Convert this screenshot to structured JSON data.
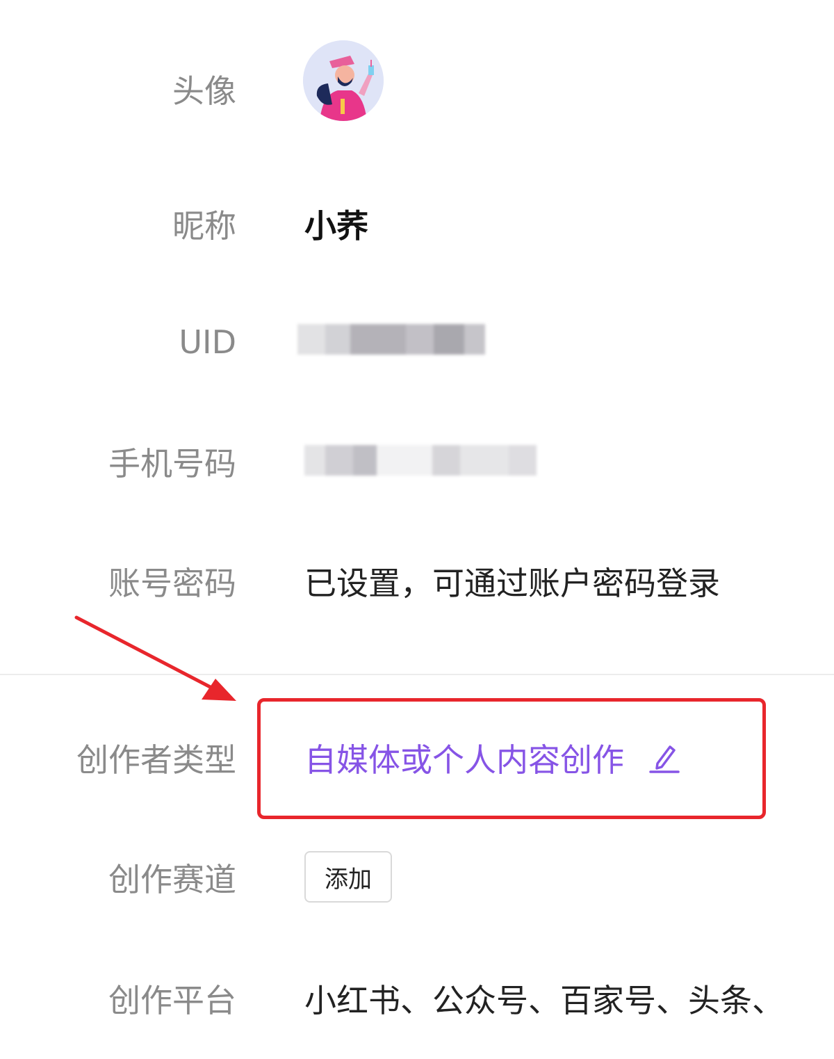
{
  "profile": {
    "avatar_label": "头像",
    "nickname_label": "昵称",
    "nickname_value": "小荞",
    "uid_label": "UID",
    "phone_label": "手机号码",
    "password_label": "账号密码",
    "password_value": "已设置，可通过账户密码登录",
    "creator_type_label": "创作者类型",
    "creator_type_value": "自媒体或个人内容创作",
    "track_label": "创作赛道",
    "track_add_button": "添加",
    "platform_label": "创作平台",
    "platform_value": "小红书、公众号、百家号、头条、"
  },
  "colors": {
    "accent": "#8654e6",
    "highlight": "#e8262c",
    "label": "#8a8a8a"
  },
  "icons": {
    "edit": "pencil-icon",
    "annotation": "red-arrow"
  }
}
